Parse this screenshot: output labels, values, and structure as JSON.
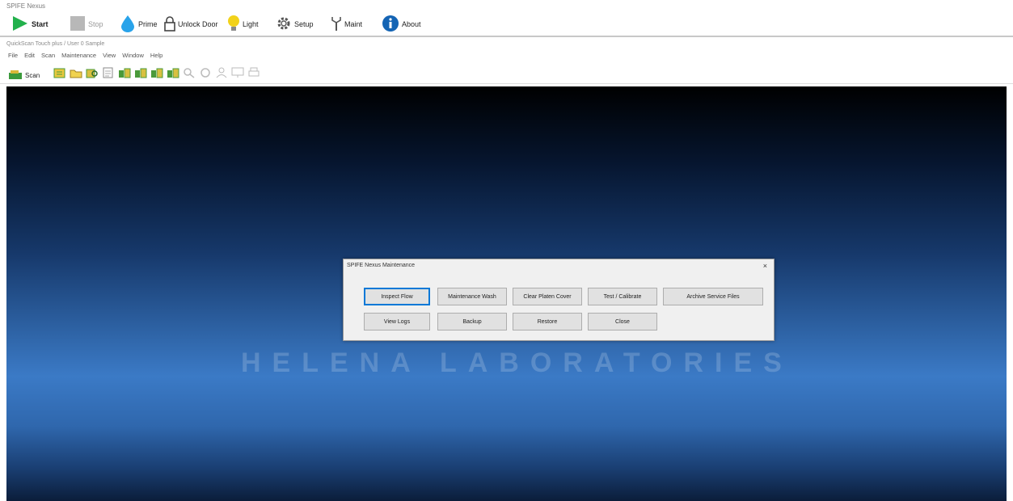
{
  "window": {
    "title": "SPIFE Nexus"
  },
  "toolbar": {
    "start": "Start",
    "stop": "Stop",
    "prime": "Prime",
    "unlock_door": "Unlock Door",
    "light": "Light",
    "setup": "Setup",
    "maint": "Maint",
    "about": "About"
  },
  "path": {
    "text": "QuickScan Touch plus / User 0 Sample"
  },
  "menu": {
    "items": [
      "File",
      "Edit",
      "Scan",
      "Maintenance",
      "View",
      "Window",
      "Help"
    ]
  },
  "toolbar2": {
    "scan_label": "Scan"
  },
  "background": {
    "brand_text": "HELENA LABORATORIES"
  },
  "dialog": {
    "title": "SPIFE Nexus Maintenance",
    "close_glyph": "×",
    "buttons": {
      "inspect_flow": "Inspect Flow",
      "maintenance_wash": "Maintenance Wash",
      "clear_platen_cover": "Clear Platen Cover",
      "test_calibrate": "Test / Calibrate",
      "archive_service_files": "Archive Service Files",
      "view_logs": "View Logs",
      "backup": "Backup",
      "restore": "Restore",
      "close": "Close"
    }
  },
  "colors": {
    "accent": "#0078d7",
    "start_green": "#22b14c",
    "prime_blue": "#29a3ea",
    "light_yellow": "#f2d21b",
    "about_blue": "#1464b4"
  }
}
